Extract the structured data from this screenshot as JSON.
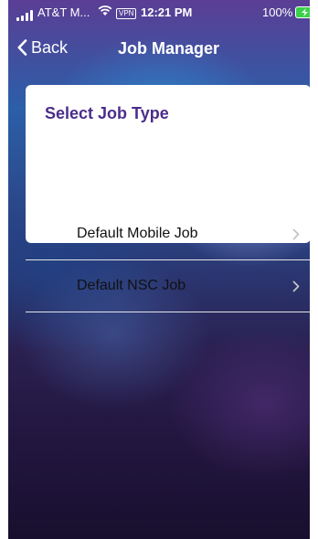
{
  "status_bar": {
    "carrier": "AT&T M...",
    "vpn_badge": "VPN",
    "time": "12:21 PM",
    "battery_percent": "100%",
    "battery_level": 1.0
  },
  "nav": {
    "back_label": "Back",
    "title": "Job Manager"
  },
  "card": {
    "title": "Select Job Type",
    "items": [
      {
        "label": "Default Mobile Job",
        "icon": "chevron-right-icon"
      },
      {
        "label": "Default NSC Job",
        "icon": "chevron-right-icon"
      }
    ]
  },
  "colors": {
    "title_accent": "#4b2d8a",
    "battery_fill": "#3ad14a",
    "chevron": "#c4c4c7"
  }
}
